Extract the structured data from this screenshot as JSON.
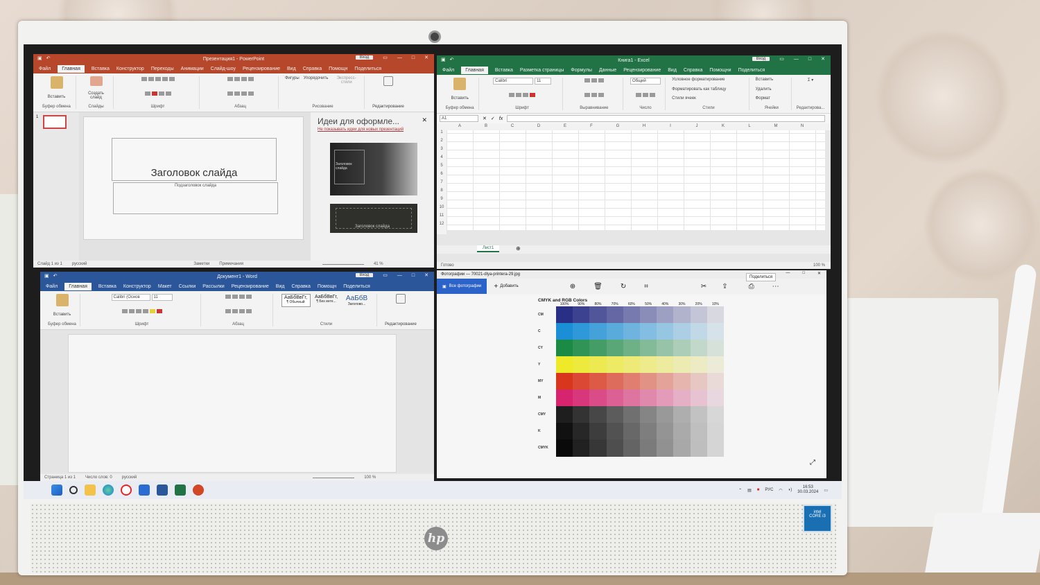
{
  "powerpoint": {
    "title": "Презентация1 - PowerPoint",
    "signin": "Вход",
    "tabs": [
      "Файл",
      "Главная",
      "Вставка",
      "Конструктор",
      "Переходы",
      "Анимации",
      "Слайд-шоу",
      "Рецензирование",
      "Вид",
      "Справка",
      "Помощн",
      "Поделиться"
    ],
    "ribbon": {
      "paste": "Вставить",
      "new_slide": "Создать слайд",
      "shapes": "Фигуры",
      "arrange": "Упорядочить",
      "quick_styles": "Экспресс-стили",
      "editing": "Редактирование",
      "groups": [
        "Буфер обмена",
        "Слайды",
        "Шрифт",
        "Абзац",
        "Рисование"
      ]
    },
    "slide_number": "1",
    "slide_title": "Заголовок слайда",
    "slide_subtitle": "Подзаголовок слайда",
    "designer": {
      "title": "Идеи для оформле...",
      "link": "Не показывать идеи для новых презентаций",
      "thumb1_title": "Заголовок слайда",
      "thumb2_title": "Заголовок слайда"
    },
    "status": {
      "slide": "Слайд 1 из 1",
      "lang": "русский",
      "notes": "Заметки",
      "comments": "Примечания",
      "zoom": "41 %"
    }
  },
  "excel": {
    "title": "Книга1 - Excel",
    "signin": "Вход",
    "tabs": [
      "Файл",
      "Главная",
      "Вставка",
      "Разметка страницы",
      "Формулы",
      "Данные",
      "Рецензирование",
      "Вид",
      "Справка",
      "Помощни",
      "Поделиться"
    ],
    "ribbon": {
      "paste": "Вставить",
      "font": "Calibri",
      "size": "11",
      "number_format": "Общий",
      "cond_format": "Условное форматирование",
      "format_table": "Форматировать как таблицу",
      "cell_styles": "Стили ячеек",
      "insert": "Вставить",
      "delete": "Удалить",
      "format": "Формат",
      "groups": [
        "Буфер обмена",
        "Шрифт",
        "Выравнивание",
        "Число",
        "Стили",
        "Ячейки",
        "Редактирова..."
      ]
    },
    "name_box": "A1",
    "formula_fx": "fx",
    "columns": [
      "A",
      "B",
      "C",
      "D",
      "E",
      "F",
      "G",
      "H",
      "I",
      "J",
      "K",
      "L",
      "M",
      "N"
    ],
    "rows": [
      "1",
      "2",
      "3",
      "4",
      "5",
      "6",
      "7",
      "8",
      "9",
      "10",
      "11",
      "12"
    ],
    "sheet_tab": "Лист1",
    "status": {
      "ready": "Готово",
      "zoom": "100 %"
    }
  },
  "word": {
    "title": "Документ1 - Word",
    "signin": "Вход",
    "tabs": [
      "Файл",
      "Главная",
      "Вставка",
      "Конструктор",
      "Макет",
      "Ссылки",
      "Рассылки",
      "Рецензирование",
      "Вид",
      "Справка",
      "Помощн",
      "Поделиться"
    ],
    "ribbon": {
      "paste": "Вставить",
      "font": "Calibri (Основ",
      "size": "11",
      "styles": [
        {
          "sample": "АаБбВвГг,",
          "name": "¶ Обычный"
        },
        {
          "sample": "АаБбВвГг,",
          "name": "¶ Без инте..."
        },
        {
          "sample": "АаБбВ",
          "name": "Заголово..."
        }
      ],
      "editing": "Редактирование",
      "groups": [
        "Буфер обмена",
        "Шрифт",
        "Абзац",
        "Стили"
      ]
    },
    "status": {
      "page": "Страница 1 из 1",
      "words": "Число слов: 0",
      "lang": "русский",
      "zoom": "100 %"
    }
  },
  "photos": {
    "title": "Фотографии — 70021-dlya-printera-29.jpg",
    "all_photos": "Все фотографии",
    "add": "Добавить",
    "tooltip": "Поделиться",
    "chart_title": "CMYK and RGB Colors",
    "percent_headers": [
      "100%",
      "90%",
      "80%",
      "70%",
      "60%",
      "50%",
      "40%",
      "30%",
      "20%",
      "10%"
    ],
    "row_labels": [
      "CM",
      "C",
      "CY",
      "Y",
      "MY",
      "M",
      "CMY",
      "K",
      "CMYK"
    ],
    "row_colors": [
      "#2a2f86",
      "#1a8fd6",
      "#1a8a45",
      "#eeea2a",
      "#d9361e",
      "#d6246e",
      "#1e1e1e",
      "#111111",
      "#0a0a0a"
    ]
  },
  "taskbar": {
    "lang": "РУС",
    "time": "16:53",
    "date": "30.03.2024"
  }
}
